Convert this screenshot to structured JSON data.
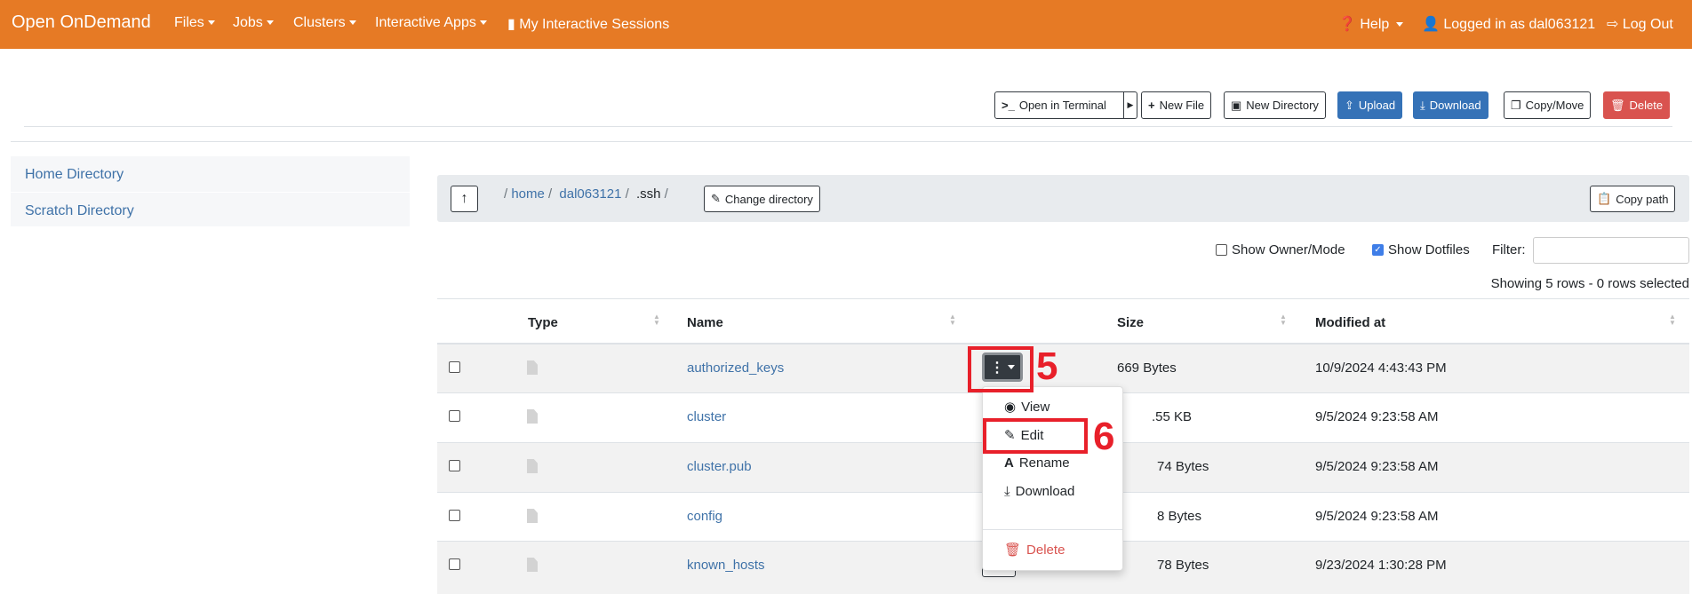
{
  "navbar": {
    "brand": "Open OnDemand",
    "items": [
      "Files",
      "Jobs",
      "Clusters",
      "Interactive Apps"
    ],
    "sessions": "My Interactive Sessions",
    "help": "Help",
    "user": "Logged in as dal063121",
    "logout": "Log Out",
    "color": "#e67a25"
  },
  "toolbar": {
    "terminal": "Open in Terminal",
    "new_file": "New File",
    "new_dir": "New Directory",
    "upload": "Upload",
    "download": "Download",
    "copy_move": "Copy/Move",
    "delete": "Delete"
  },
  "sidebar": {
    "items": [
      "Home Directory",
      "Scratch Directory"
    ]
  },
  "breadcrumb": {
    "parts": [
      "home",
      "dal063121",
      ".ssh"
    ],
    "change": "Change directory",
    "copy_path": "Copy path"
  },
  "options": {
    "owner": "Show Owner/Mode",
    "owner_checked": false,
    "dotfiles": "Show Dotfiles",
    "dotfiles_checked": true,
    "filter_label": "Filter:",
    "filter_value": ""
  },
  "status": "Showing 5 rows - 0 rows selected",
  "table": {
    "headers": [
      "Type",
      "Name",
      "Size",
      "Modified at"
    ],
    "rows": [
      {
        "name": "authorized_keys",
        "size": "669 Bytes",
        "modified": "10/9/2024 4:43:43 PM"
      },
      {
        "name": "cluster",
        "size": ".55 KB",
        "modified": "9/5/2024 9:23:58 AM"
      },
      {
        "name": "cluster.pub",
        "size": "74 Bytes",
        "modified": "9/5/2024 9:23:58 AM"
      },
      {
        "name": "config",
        "size": "8 Bytes",
        "modified": "9/5/2024 9:23:58 AM"
      },
      {
        "name": "known_hosts",
        "size": "78 Bytes",
        "modified": "9/23/2024 1:30:28 PM"
      }
    ]
  },
  "menu": {
    "view": "View",
    "edit": "Edit",
    "rename": "Rename",
    "download": "Download",
    "delete": "Delete"
  },
  "annotations": {
    "step1": "5",
    "step2": "6"
  }
}
